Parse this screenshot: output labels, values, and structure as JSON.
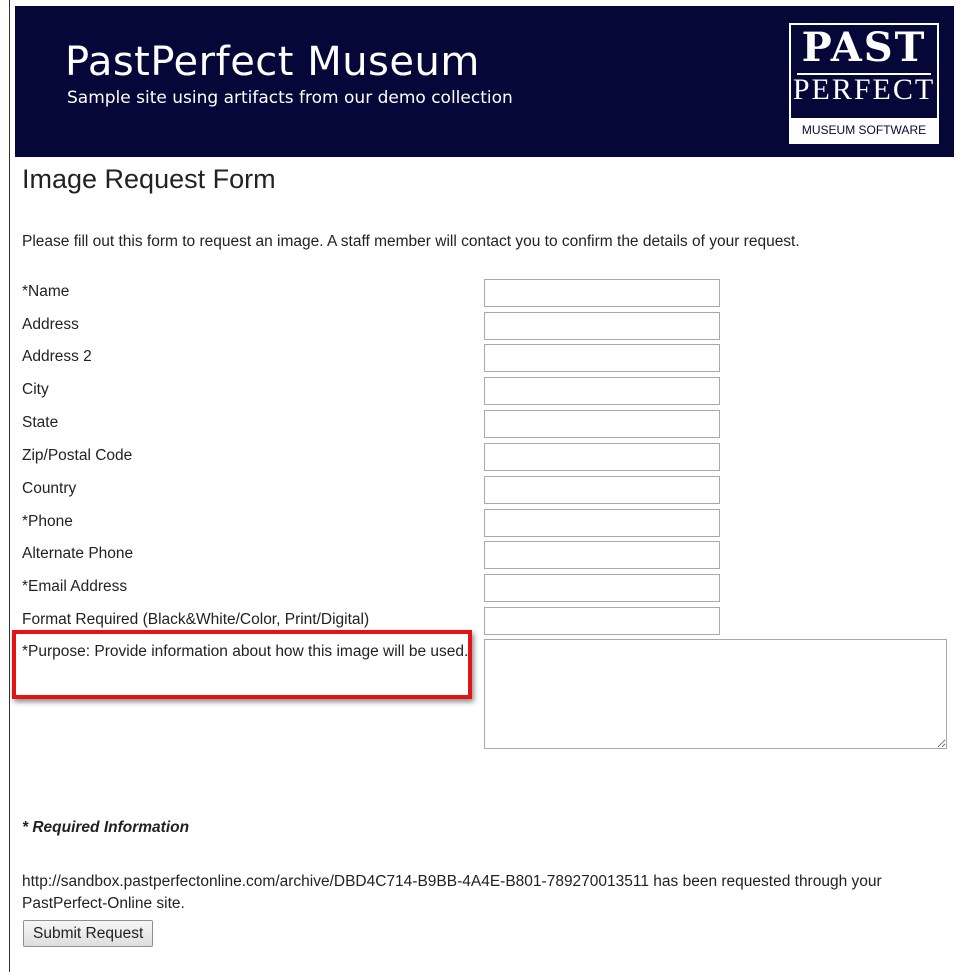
{
  "header": {
    "title": "PastPerfect Museum",
    "subtitle": "Sample site using artifacts from our demo collection",
    "logo": {
      "line1": "PAST",
      "line2": "PERFECT",
      "line3": "MUSEUM SOFTWARE"
    },
    "background_color": "#040737"
  },
  "page": {
    "title": "Image Request Form",
    "intro": "Please fill out this form to request an image. A staff member will contact you to confirm the details of your request."
  },
  "form": {
    "fields": [
      {
        "label": "*Name",
        "value": ""
      },
      {
        "label": "Address",
        "value": ""
      },
      {
        "label": "Address 2",
        "value": ""
      },
      {
        "label": "City",
        "value": ""
      },
      {
        "label": "State",
        "value": ""
      },
      {
        "label": "Zip/Postal Code",
        "value": ""
      },
      {
        "label": "Country",
        "value": ""
      },
      {
        "label": "*Phone",
        "value": ""
      },
      {
        "label": "Alternate Phone",
        "value": ""
      },
      {
        "label": "*Email Address",
        "value": ""
      },
      {
        "label": "Format Required (Black&White/Color, Print/Digital)",
        "value": ""
      }
    ],
    "purpose": {
      "label": "*Purpose: Provide information about how this image will be used.",
      "value": ""
    },
    "required_note": "* Required Information",
    "request_message": "http://sandbox.pastperfectonline.com/archive/DBD4C714-B9BB-4A4E-B801-789270013511 has been requested through your PastPerfect-Online site.",
    "submit_label": "Submit Request"
  },
  "colors": {
    "highlight": "#e31414",
    "header_bg": "#040737"
  }
}
